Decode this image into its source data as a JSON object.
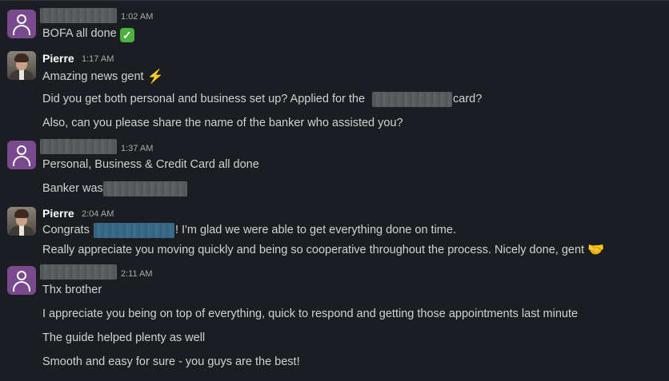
{
  "messages": [
    {
      "sender": "",
      "time": "1:02 AM",
      "lines": [
        {
          "text": "BOFA all done",
          "emoji": "white-check-mark"
        }
      ]
    },
    {
      "sender": "Pierre",
      "time": "1:17 AM",
      "lines": [
        {
          "text": "Amazing news gent",
          "emoji": "high-voltage"
        },
        {
          "text_before": "Did you get both personal and business set up? Applied for the",
          "text_after": "card?"
        },
        {
          "text": "Also, can you please share the name of the banker who assisted you?"
        }
      ]
    },
    {
      "sender": "",
      "time": "1:37 AM",
      "lines": [
        {
          "text": "Personal, Business & Credit Card all done"
        },
        {
          "text": "Banker was"
        }
      ]
    },
    {
      "sender": "Pierre",
      "time": "2:04 AM",
      "lines": [
        {
          "text_before": "Congrats",
          "text_after": "! I'm glad we were able to get everything done on time."
        },
        {
          "text": "Really appreciate you moving quickly and being so cooperative throughout the process. Nicely done, gent",
          "emoji": "handshake"
        }
      ]
    },
    {
      "sender": "",
      "time": "2:11 AM",
      "lines": [
        {
          "text": "Thx brother"
        },
        {
          "text": "I appreciate you being on top of everything, quick to respond and getting those appointments last minute"
        },
        {
          "text": "The guide helped plenty as well"
        },
        {
          "text": "Smooth and easy for sure - you guys are the best!"
        }
      ]
    }
  ]
}
